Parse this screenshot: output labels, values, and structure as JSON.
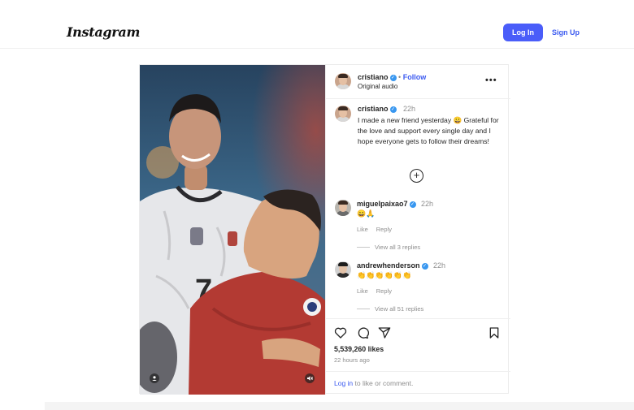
{
  "app": {
    "logo_text": "Instagram",
    "login_label": "Log In",
    "signup_label": "Sign Up",
    "accent_color": "#4a5df9"
  },
  "post": {
    "author": "cristiano",
    "follow_separator": "•",
    "follow_label": "Follow",
    "audio_label": "Original audio",
    "more_icon": "ellipsis-icon",
    "caption": {
      "author": "cristiano",
      "time": "22h",
      "text": "I made a new friend yesterday 😀 Grateful for the love and support every single day and I hope everyone gets to follow their dreams!"
    },
    "load_more_icon": "plus-circle-icon",
    "comments": [
      {
        "user": "miguelpaixao7",
        "time": "22h",
        "text": "😀🙏",
        "like_label": "Like",
        "reply_label": "Reply",
        "view_replies": "View all 3 replies"
      },
      {
        "user": "andrewhenderson",
        "time": "22h",
        "text": "👏👏👏👏👏👏",
        "like_label": "Like",
        "reply_label": "Reply",
        "view_replies": "View all 51 replies"
      }
    ],
    "likes": "5,539,260 likes",
    "time_ago": "22 hours ago",
    "login_link": "Log in",
    "login_suffix": " to like or comment."
  }
}
